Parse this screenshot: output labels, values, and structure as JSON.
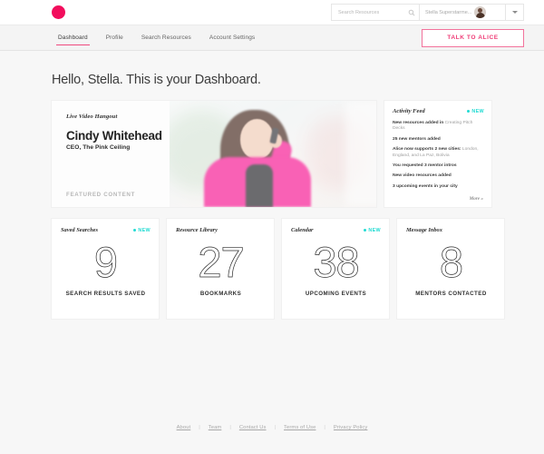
{
  "topbar": {
    "logo_name": "pink-circle-logo",
    "search": {
      "placeholder": "Search Resources",
      "value": "",
      "icon": "search-icon"
    },
    "user": {
      "name": "Stella Superstarme...",
      "avatar": "user-avatar",
      "caret": "chevron-down-icon"
    }
  },
  "nav": {
    "items": [
      {
        "label": "Dashboard",
        "active": true
      },
      {
        "label": "Profile",
        "active": false
      },
      {
        "label": "Search Resources",
        "active": false
      },
      {
        "label": "Account Settings",
        "active": false
      }
    ],
    "cta_label": "TALK TO ALICE"
  },
  "main": {
    "greeting": "Hello, Stella. This is your Dashboard.",
    "hero": {
      "kicker": "Live Video Hangout",
      "name": "Cindy Whitehead",
      "role": "CEO, The Pink Ceiling",
      "featured_label": "FEATURED CONTENT"
    },
    "feed": {
      "title": "Activity Feed",
      "badge": "NEW",
      "items": [
        {
          "strong": "New resources added in ",
          "muted": "Creating Pitch Decks"
        },
        {
          "strong": "25 new mentors added",
          "muted": ""
        },
        {
          "strong": "Alice now supports 2 new cities: ",
          "muted": "London, England, and La Paz, Bolivia"
        },
        {
          "strong": "You requested 3 mentor intros",
          "muted": ""
        },
        {
          "strong": "New video resources added",
          "muted": ""
        },
        {
          "strong": "3 upcoming events in your city",
          "muted": ""
        }
      ],
      "more_label": "More »"
    },
    "stats": [
      {
        "title": "Saved Searches",
        "badge": "NEW",
        "value": "9",
        "label": "SEARCH RESULTS SAVED"
      },
      {
        "title": "Resource Library",
        "badge": "",
        "value": "27",
        "label": "BOOKMARKS"
      },
      {
        "title": "Calendar",
        "badge": "NEW",
        "value": "38",
        "label": "UPCOMING EVENTS"
      },
      {
        "title": "Message Inbox",
        "badge": "",
        "value": "8",
        "label": "MENTORS CONTACTED"
      }
    ]
  },
  "footer": {
    "links": [
      "About",
      "Team",
      "Contact Us",
      "Terms of Use",
      "Privacy Policy"
    ],
    "separator": "|"
  },
  "colors": {
    "brand_pink": "#f20d5c",
    "cta_pink": "#ef3d77",
    "accent_cyan": "#23dbd3",
    "page_bg": "#f7f7f7"
  }
}
